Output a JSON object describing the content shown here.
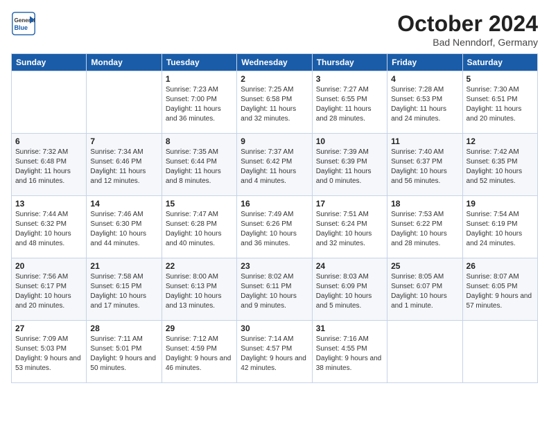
{
  "header": {
    "logo_text_general": "General",
    "logo_text_blue": "Blue",
    "month_year": "October 2024",
    "location": "Bad Nenndorf, Germany"
  },
  "weekdays": [
    "Sunday",
    "Monday",
    "Tuesday",
    "Wednesday",
    "Thursday",
    "Friday",
    "Saturday"
  ],
  "weeks": [
    [
      {
        "day": "",
        "detail": ""
      },
      {
        "day": "",
        "detail": ""
      },
      {
        "day": "1",
        "detail": "Sunrise: 7:23 AM\nSunset: 7:00 PM\nDaylight: 11 hours\nand 36 minutes."
      },
      {
        "day": "2",
        "detail": "Sunrise: 7:25 AM\nSunset: 6:58 PM\nDaylight: 11 hours\nand 32 minutes."
      },
      {
        "day": "3",
        "detail": "Sunrise: 7:27 AM\nSunset: 6:55 PM\nDaylight: 11 hours\nand 28 minutes."
      },
      {
        "day": "4",
        "detail": "Sunrise: 7:28 AM\nSunset: 6:53 PM\nDaylight: 11 hours\nand 24 minutes."
      },
      {
        "day": "5",
        "detail": "Sunrise: 7:30 AM\nSunset: 6:51 PM\nDaylight: 11 hours\nand 20 minutes."
      }
    ],
    [
      {
        "day": "6",
        "detail": "Sunrise: 7:32 AM\nSunset: 6:48 PM\nDaylight: 11 hours\nand 16 minutes."
      },
      {
        "day": "7",
        "detail": "Sunrise: 7:34 AM\nSunset: 6:46 PM\nDaylight: 11 hours\nand 12 minutes."
      },
      {
        "day": "8",
        "detail": "Sunrise: 7:35 AM\nSunset: 6:44 PM\nDaylight: 11 hours\nand 8 minutes."
      },
      {
        "day": "9",
        "detail": "Sunrise: 7:37 AM\nSunset: 6:42 PM\nDaylight: 11 hours\nand 4 minutes."
      },
      {
        "day": "10",
        "detail": "Sunrise: 7:39 AM\nSunset: 6:39 PM\nDaylight: 11 hours\nand 0 minutes."
      },
      {
        "day": "11",
        "detail": "Sunrise: 7:40 AM\nSunset: 6:37 PM\nDaylight: 10 hours\nand 56 minutes."
      },
      {
        "day": "12",
        "detail": "Sunrise: 7:42 AM\nSunset: 6:35 PM\nDaylight: 10 hours\nand 52 minutes."
      }
    ],
    [
      {
        "day": "13",
        "detail": "Sunrise: 7:44 AM\nSunset: 6:32 PM\nDaylight: 10 hours\nand 48 minutes."
      },
      {
        "day": "14",
        "detail": "Sunrise: 7:46 AM\nSunset: 6:30 PM\nDaylight: 10 hours\nand 44 minutes."
      },
      {
        "day": "15",
        "detail": "Sunrise: 7:47 AM\nSunset: 6:28 PM\nDaylight: 10 hours\nand 40 minutes."
      },
      {
        "day": "16",
        "detail": "Sunrise: 7:49 AM\nSunset: 6:26 PM\nDaylight: 10 hours\nand 36 minutes."
      },
      {
        "day": "17",
        "detail": "Sunrise: 7:51 AM\nSunset: 6:24 PM\nDaylight: 10 hours\nand 32 minutes."
      },
      {
        "day": "18",
        "detail": "Sunrise: 7:53 AM\nSunset: 6:22 PM\nDaylight: 10 hours\nand 28 minutes."
      },
      {
        "day": "19",
        "detail": "Sunrise: 7:54 AM\nSunset: 6:19 PM\nDaylight: 10 hours\nand 24 minutes."
      }
    ],
    [
      {
        "day": "20",
        "detail": "Sunrise: 7:56 AM\nSunset: 6:17 PM\nDaylight: 10 hours\nand 20 minutes."
      },
      {
        "day": "21",
        "detail": "Sunrise: 7:58 AM\nSunset: 6:15 PM\nDaylight: 10 hours\nand 17 minutes."
      },
      {
        "day": "22",
        "detail": "Sunrise: 8:00 AM\nSunset: 6:13 PM\nDaylight: 10 hours\nand 13 minutes."
      },
      {
        "day": "23",
        "detail": "Sunrise: 8:02 AM\nSunset: 6:11 PM\nDaylight: 10 hours\nand 9 minutes."
      },
      {
        "day": "24",
        "detail": "Sunrise: 8:03 AM\nSunset: 6:09 PM\nDaylight: 10 hours\nand 5 minutes."
      },
      {
        "day": "25",
        "detail": "Sunrise: 8:05 AM\nSunset: 6:07 PM\nDaylight: 10 hours\nand 1 minute."
      },
      {
        "day": "26",
        "detail": "Sunrise: 8:07 AM\nSunset: 6:05 PM\nDaylight: 9 hours\nand 57 minutes."
      }
    ],
    [
      {
        "day": "27",
        "detail": "Sunrise: 7:09 AM\nSunset: 5:03 PM\nDaylight: 9 hours\nand 53 minutes."
      },
      {
        "day": "28",
        "detail": "Sunrise: 7:11 AM\nSunset: 5:01 PM\nDaylight: 9 hours\nand 50 minutes."
      },
      {
        "day": "29",
        "detail": "Sunrise: 7:12 AM\nSunset: 4:59 PM\nDaylight: 9 hours\nand 46 minutes."
      },
      {
        "day": "30",
        "detail": "Sunrise: 7:14 AM\nSunset: 4:57 PM\nDaylight: 9 hours\nand 42 minutes."
      },
      {
        "day": "31",
        "detail": "Sunrise: 7:16 AM\nSunset: 4:55 PM\nDaylight: 9 hours\nand 38 minutes."
      },
      {
        "day": "",
        "detail": ""
      },
      {
        "day": "",
        "detail": ""
      }
    ]
  ]
}
